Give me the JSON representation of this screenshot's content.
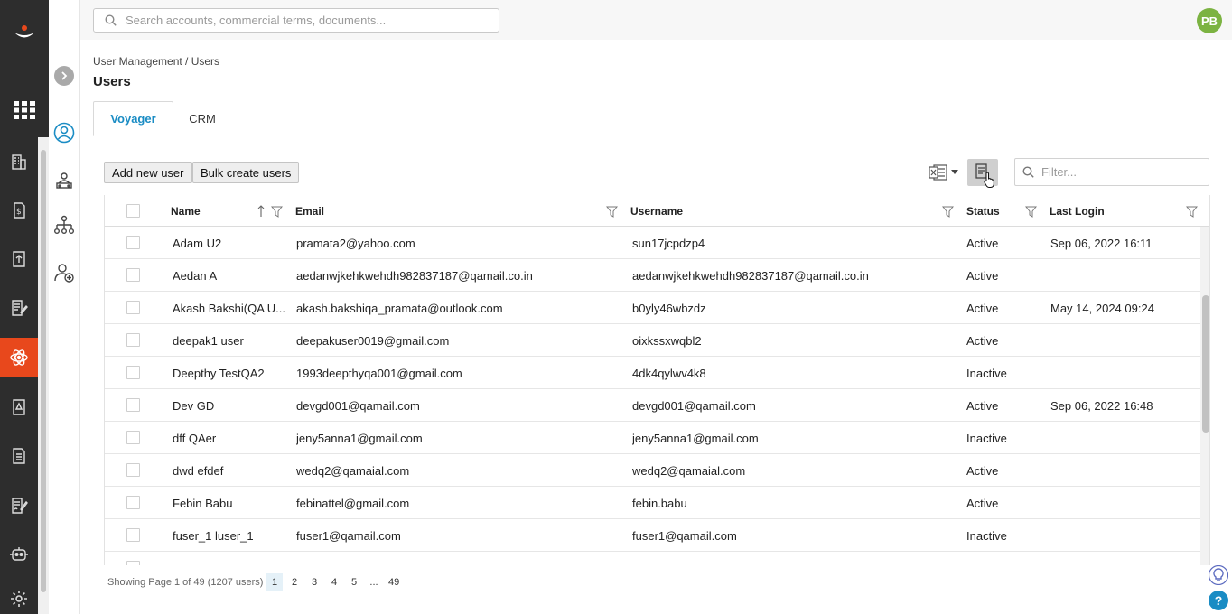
{
  "search": {
    "placeholder": "Search accounts, commercial terms, documents..."
  },
  "user": {
    "initials": "PB",
    "color": "#7cb342"
  },
  "breadcrumb": "User Management / Users",
  "page_title": "Users",
  "tabs": [
    {
      "label": "Voyager",
      "active": true
    },
    {
      "label": "CRM",
      "active": false
    }
  ],
  "toolbar": {
    "add_user_label": "Add new user",
    "bulk_create_label": "Bulk create users",
    "filter_placeholder": "Filter..."
  },
  "columns": [
    "Name",
    "Email",
    "Username",
    "Status",
    "Last Login"
  ],
  "sort": {
    "column": "Name",
    "direction": "ascending"
  },
  "rows": [
    {
      "name": "Adam U2",
      "email": "pramata2@yahoo.com",
      "username": "sun17jcpdzp4",
      "status": "Active",
      "last_login": "Sep 06, 2022 16:11"
    },
    {
      "name": "Aedan A",
      "email": "aedanwjkehkwehdh982837187@qamail.co.in",
      "username": "aedanwjkehkwehdh982837187@qamail.co.in",
      "status": "Active",
      "last_login": ""
    },
    {
      "name": "Akash Bakshi(QA U...",
      "email": "akash.bakshiqa_pramata@outlook.com",
      "username": "b0yly46wbzdz",
      "status": "Active",
      "last_login": "May 14, 2024 09:24"
    },
    {
      "name": "deepak1 user",
      "email": "deepakuser0019@gmail.com",
      "username": "oixkssxwqbl2",
      "status": "Active",
      "last_login": ""
    },
    {
      "name": "Deepthy TestQA2",
      "email": "1993deepthyqa001@gmail.com",
      "username": "4dk4qylwv4k8",
      "status": "Inactive",
      "last_login": ""
    },
    {
      "name": "Dev GD",
      "email": "devgd001@qamail.com",
      "username": "devgd001@qamail.com",
      "status": "Active",
      "last_login": "Sep 06, 2022 16:48"
    },
    {
      "name": "dff QAer",
      "email": "jeny5anna1@gmail.com",
      "username": "jeny5anna1@gmail.com",
      "status": "Inactive",
      "last_login": ""
    },
    {
      "name": "dwd efdef",
      "email": "wedq2@qamaial.com",
      "username": "wedq2@qamaial.com",
      "status": "Active",
      "last_login": ""
    },
    {
      "name": "Febin Babu",
      "email": "febinattel@gmail.com",
      "username": "febin.babu",
      "status": "Active",
      "last_login": ""
    },
    {
      "name": "fuser_1 luser_1",
      "email": "fuser1@qamail.com",
      "username": "fuser1@qamail.com",
      "status": "Inactive",
      "last_login": ""
    }
  ],
  "pagination": {
    "summary": "Showing Page 1 of 49 (1207 users)",
    "pages": [
      "1",
      "2",
      "3",
      "4",
      "5",
      "...",
      "49"
    ],
    "current": "1"
  },
  "colors": {
    "accent_orange": "#e8481c",
    "tab_active": "#1a8cc4",
    "help": "#1a8cc4",
    "idea": "#5c6bc0"
  },
  "icons": {
    "rail": [
      "grid-icon",
      "building-icon",
      "contract-dollar-icon",
      "upload-doc-icon",
      "edit-doc-icon",
      "atom-icon",
      "alert-doc-icon",
      "document-icon",
      "sign-doc-icon",
      "bot-icon",
      "settings-icon"
    ],
    "subnav": [
      "user-circle-icon",
      "users-group-icon",
      "org-chart-icon",
      "add-user-icon"
    ]
  }
}
